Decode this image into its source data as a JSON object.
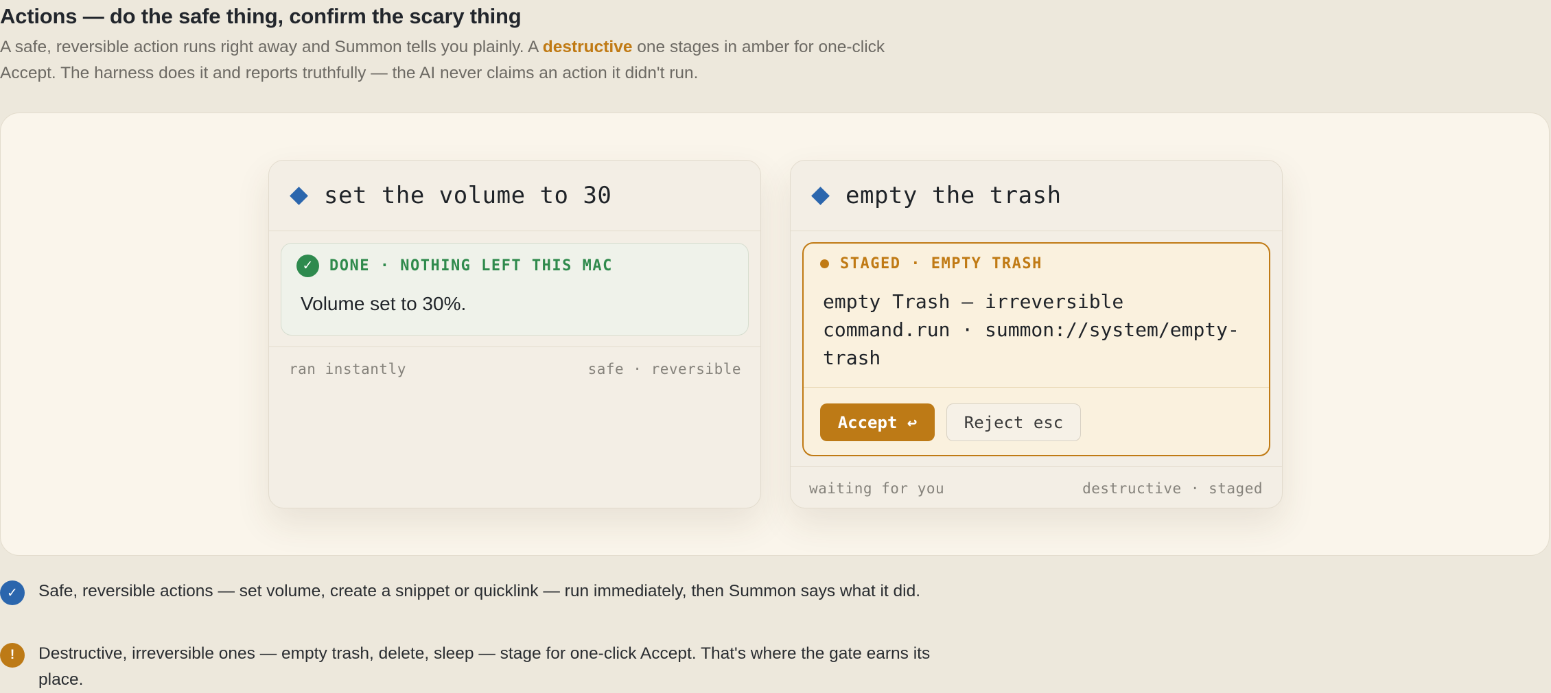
{
  "page": {
    "title": "Actions — do the safe thing, confirm the scary thing",
    "intro_before": "A safe, reversible action runs right away and Summon tells you plainly. A ",
    "intro_highlight": "destructive",
    "intro_after": " one stages in amber for one-click Accept. The harness does it and reports truthfully — the AI never claims an action it didn't run."
  },
  "safe_card": {
    "icon": "diamond-icon",
    "title": "set the volume to 30",
    "status_icon": "check-icon",
    "status_label": "DONE · NOTHING LEFT THIS MAC",
    "message": "Volume set to 30%.",
    "footer_left": "ran instantly",
    "footer_right": "safe · reversible"
  },
  "destructive_card": {
    "icon": "diamond-icon",
    "title": "empty the trash",
    "status_icon": "dot-icon",
    "status_label": "STAGED · EMPTY TRASH",
    "command_line1": "empty Trash — irreversible",
    "command_line2": "command.run · summon://system/empty-trash",
    "accept_label": "Accept ↩",
    "reject_label": "Reject esc",
    "footer_left": "waiting for you",
    "footer_right": "destructive · staged"
  },
  "notes": [
    {
      "icon": "check-icon",
      "glyph": "✓",
      "text": "Safe, reversible actions — set volume, create a snippet or quicklink — run immediately, then Summon says what it did."
    },
    {
      "icon": "warning-icon",
      "glyph": "!",
      "text": "Destructive, irreversible ones — empty trash, delete, sleep — stage for one-click Accept. That's where the gate earns its place."
    }
  ],
  "colors": {
    "background": "#ede8dc",
    "accent_blue": "#2b66ad",
    "success_green": "#2e8a4e",
    "warning_amber": "#bd7a16"
  }
}
